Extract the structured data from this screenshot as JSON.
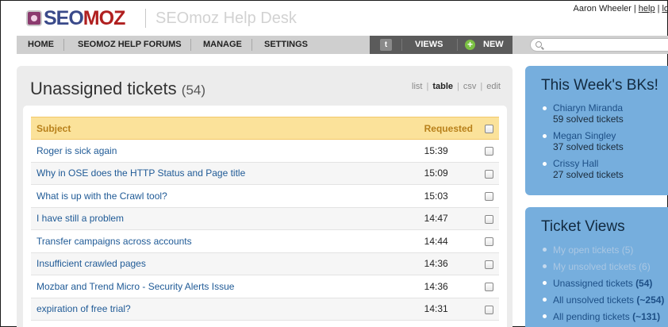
{
  "header": {
    "logo_seo": "SEO",
    "logo_moz": "MOZ",
    "helpdesk_title": "SEOmoz Help Desk",
    "user_name": "Aaron Wheeler",
    "help_link": "help",
    "logout_link_partial": "lo"
  },
  "nav": {
    "home": "HOME",
    "forums": "SEOMOZ HELP FORUMS",
    "manage": "MANAGE",
    "settings": "SETTINGS",
    "twitter_glyph": "t",
    "views": "VIEWS",
    "new": "NEW",
    "plus_glyph": "+",
    "search_placeholder": ""
  },
  "main": {
    "title": "Unassigned tickets",
    "count": "(54)",
    "view_options": {
      "list": "list",
      "table": "table",
      "csv": "csv",
      "edit": "edit",
      "separator": "|"
    },
    "table": {
      "columns": {
        "subject": "Subject",
        "requested": "Requested"
      },
      "rows": [
        {
          "subject": "Roger is sick again",
          "time": "15:39"
        },
        {
          "subject": "Why in OSE does the HTTP Status and Page title",
          "time": "15:09"
        },
        {
          "subject": "What is up with the Crawl tool?",
          "time": "15:03"
        },
        {
          "subject": "I have still a problem",
          "time": "14:47"
        },
        {
          "subject": "Transfer campaigns across accounts",
          "time": "14:44"
        },
        {
          "subject": "Insufficient crawled pages",
          "time": "14:36"
        },
        {
          "subject": "Mozbar and Trend Micro - Security Alerts Issue",
          "time": "14:36"
        },
        {
          "subject": "expiration of free trial?",
          "time": "14:31"
        }
      ]
    }
  },
  "bks_panel": {
    "title": "This Week's BKs!",
    "items": [
      {
        "name": "Chiaryn Miranda",
        "sub": "59 solved tickets"
      },
      {
        "name": "Megan Singley",
        "sub": "37 solved tickets"
      },
      {
        "name": "Crissy Hall",
        "sub": "27 solved tickets"
      }
    ]
  },
  "views_panel": {
    "title": "Ticket Views",
    "items": [
      {
        "label": "My open tickets",
        "count": "(5)",
        "dim": true
      },
      {
        "label": "My unsolved tickets",
        "count": "(6)",
        "dim": true
      },
      {
        "label": "Unassigned tickets",
        "count": "(54)",
        "dim": false
      },
      {
        "label": "All unsolved tickets",
        "count": "(~254)",
        "dim": false
      },
      {
        "label": "All pending tickets",
        "count": "(~131)",
        "dim": false
      }
    ]
  },
  "colors": {
    "nav_bg": "#cfcfcf",
    "nav_dark": "#5b5b5b",
    "table_header": "#fbe29a",
    "link_blue": "#1f5a96",
    "side_panel": "#76aedd",
    "add_green": "#7bc143"
  }
}
